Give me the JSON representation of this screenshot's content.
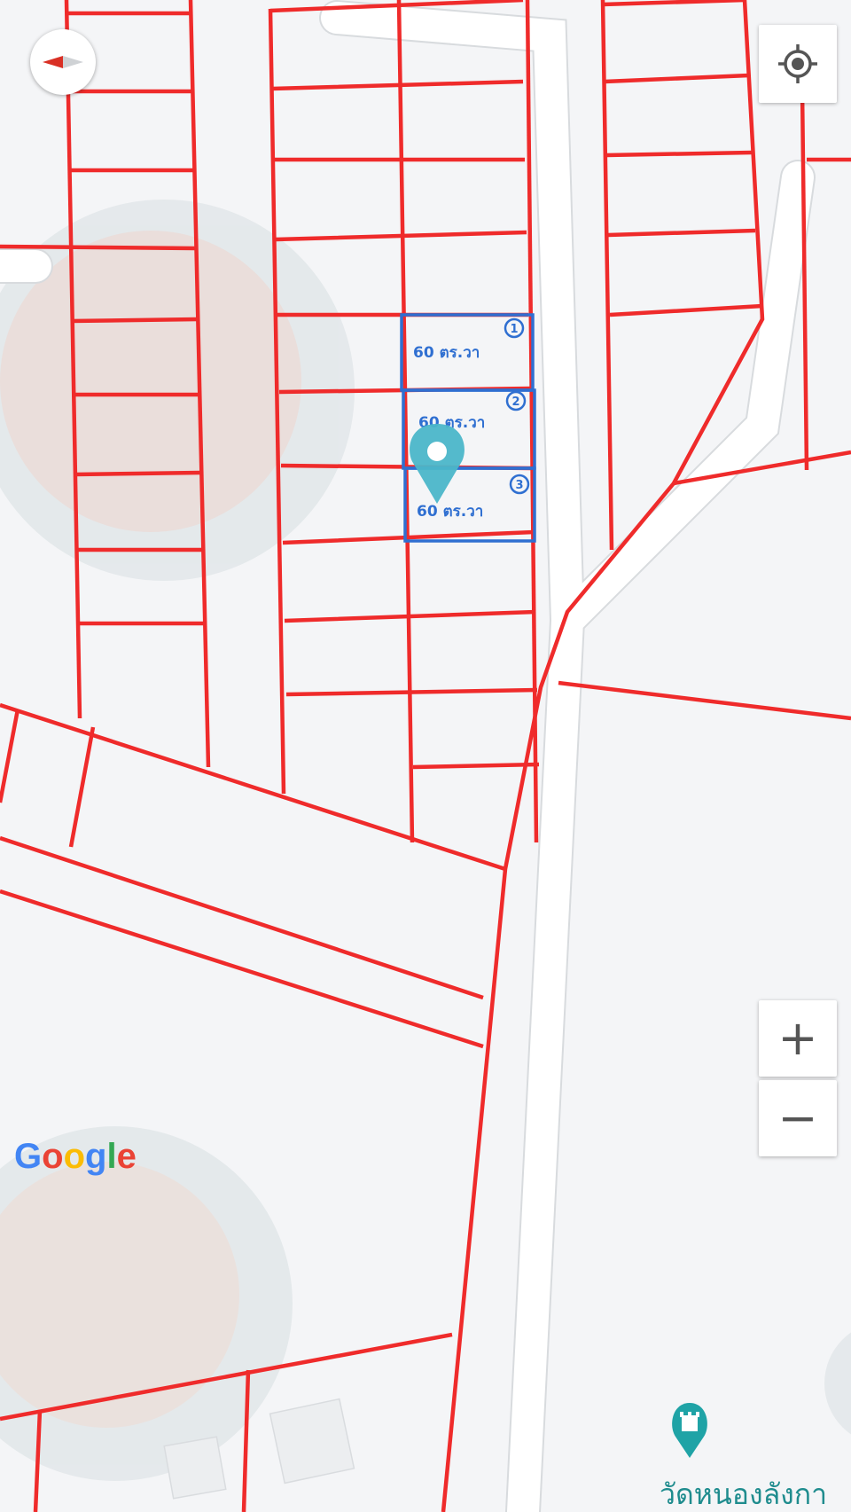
{
  "map": {
    "colors": {
      "background": "#f4f5f7",
      "road": "#ffffff",
      "parcel_line": "#ef2b2b",
      "highlight": "#2f6fd1",
      "marker": "#4bb6c9",
      "poi": "#1fa3a6"
    },
    "highlighted_plots": [
      {
        "number": "1",
        "label": "60 ตร.วา"
      },
      {
        "number": "2",
        "label": "60 ตร.วา"
      },
      {
        "number": "3",
        "label": "60 ตร.วา"
      }
    ],
    "poi": {
      "icon": "temple-icon",
      "label": "วัดหนองลังกา"
    },
    "attribution": [
      "G",
      "o",
      "o",
      "g",
      "l",
      "e"
    ]
  },
  "controls": {
    "compass_icon": "compass-icon",
    "locate_icon": "my-location-icon",
    "zoom_in_label": "+",
    "zoom_out_label": "−"
  }
}
